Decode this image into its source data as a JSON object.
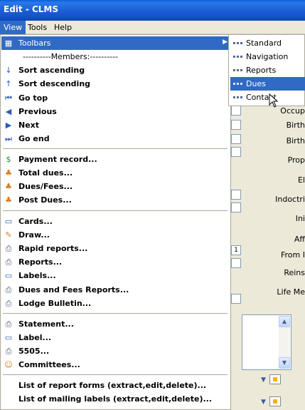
{
  "window": {
    "title": "Edit - CLMS"
  },
  "menubar": [
    {
      "label": "View",
      "active": true
    },
    {
      "label": "Tools",
      "active": false
    },
    {
      "label": "Help",
      "active": false
    }
  ],
  "view_menu": {
    "toolbars_label": "Toolbars",
    "members_header": "----------Members:----------",
    "sort_ascending": "Sort ascending",
    "sort_descending": "Sort descending",
    "go_top": "Go top",
    "previous": "Previous",
    "next": "Next",
    "go_end": "Go end",
    "payment_record": "Payment record...",
    "total_dues": "Total dues...",
    "dues_fees": "Dues/Fees...",
    "post_dues": "Post Dues...",
    "cards": "Cards...",
    "draw": "Draw...",
    "rapid_reports": "Rapid reports...",
    "reports": "Reports...",
    "labels": "Labels...",
    "dues_fees_reports": "Dues and Fees Reports...",
    "lodge_bulletin": "Lodge Bulletin...",
    "statement": "Statement...",
    "label": "Label...",
    "form_5505": "5505...",
    "committees": "Committees...",
    "list_report_forms": "List of report forms (extract,edit,delete)...",
    "list_mailing_labels": "List of mailing labels (extract,edit,delete)..."
  },
  "toolbars_submenu": [
    {
      "label": "Standard",
      "selected": false
    },
    {
      "label": "Navigation",
      "selected": false
    },
    {
      "label": "Reports",
      "selected": false
    },
    {
      "label": "Dues",
      "selected": true
    },
    {
      "label": "Contact",
      "selected": false
    }
  ],
  "form": {
    "occupation_label": "Occup",
    "birth_label_1": "Birth",
    "birth_label_2": "Birth",
    "prop_label": "Prop",
    "el_label": "El",
    "indoctri_label": "Indoctri",
    "ini_label": "Ini",
    "aff_label": "Aff",
    "from_label": "From I",
    "reins_label": "Reins",
    "life_label": "Life Me",
    "field_value_1": "1"
  },
  "colors": {
    "highlight": "#316ac5",
    "titlebar": "#1c5fd6"
  }
}
